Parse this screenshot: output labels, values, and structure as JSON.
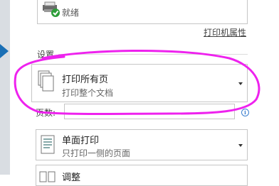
{
  "printer": {
    "status": "就绪",
    "properties_link": "打印机属性",
    "status_icon": "check-icon"
  },
  "settings": {
    "title": "设置",
    "page_range": {
      "title": "打印所有页",
      "subtitle": "打印整个文档",
      "icon": "pages-stack-icon"
    },
    "pages_label": "页数:",
    "pages_value": "",
    "sides": {
      "title": "单面打印",
      "subtitle": "只打印一侧的页面",
      "icon": "single-page-icon"
    },
    "collate": {
      "title": "调整"
    }
  },
  "annotation_color": "#ee22ee"
}
